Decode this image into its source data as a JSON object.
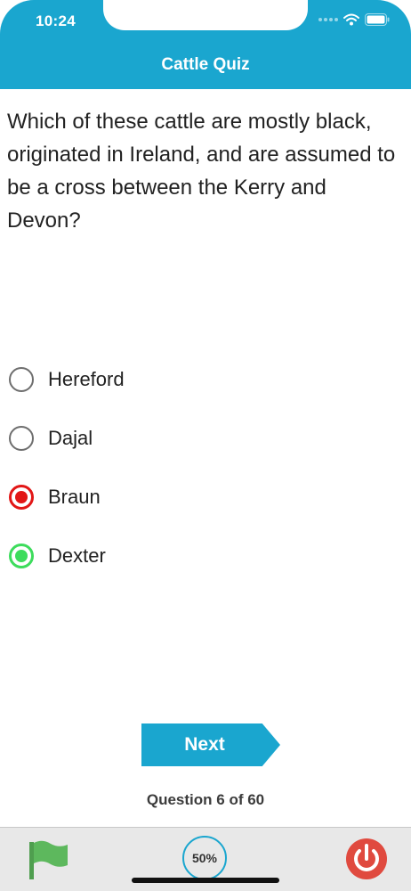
{
  "status_bar": {
    "time": "10:24"
  },
  "nav": {
    "title": "Cattle Quiz"
  },
  "question": {
    "text": "Which of these cattle are mostly black, originated in Ireland, and are assumed to be a cross between the Kerry and Devon?"
  },
  "options": [
    {
      "label": "Hereford",
      "state": "unselected"
    },
    {
      "label": "Dajal",
      "state": "unselected"
    },
    {
      "label": "Braun",
      "state": "incorrect-selected"
    },
    {
      "label": "Dexter",
      "state": "correct"
    }
  ],
  "next_button": {
    "label": "Next"
  },
  "progress": {
    "text": "Question 6 of 60",
    "current": 6,
    "total": 60
  },
  "tabbar": {
    "percent_label": "50%",
    "percent_value": 50
  },
  "colors": {
    "accent": "#1aa6cf",
    "incorrect": "#e21616",
    "correct": "#3ddc5c",
    "power": "#e04a3f",
    "flag": "#5db85d"
  },
  "icons": [
    "signal-dots-icon",
    "wifi-icon",
    "battery-icon",
    "flag-icon",
    "power-icon"
  ]
}
